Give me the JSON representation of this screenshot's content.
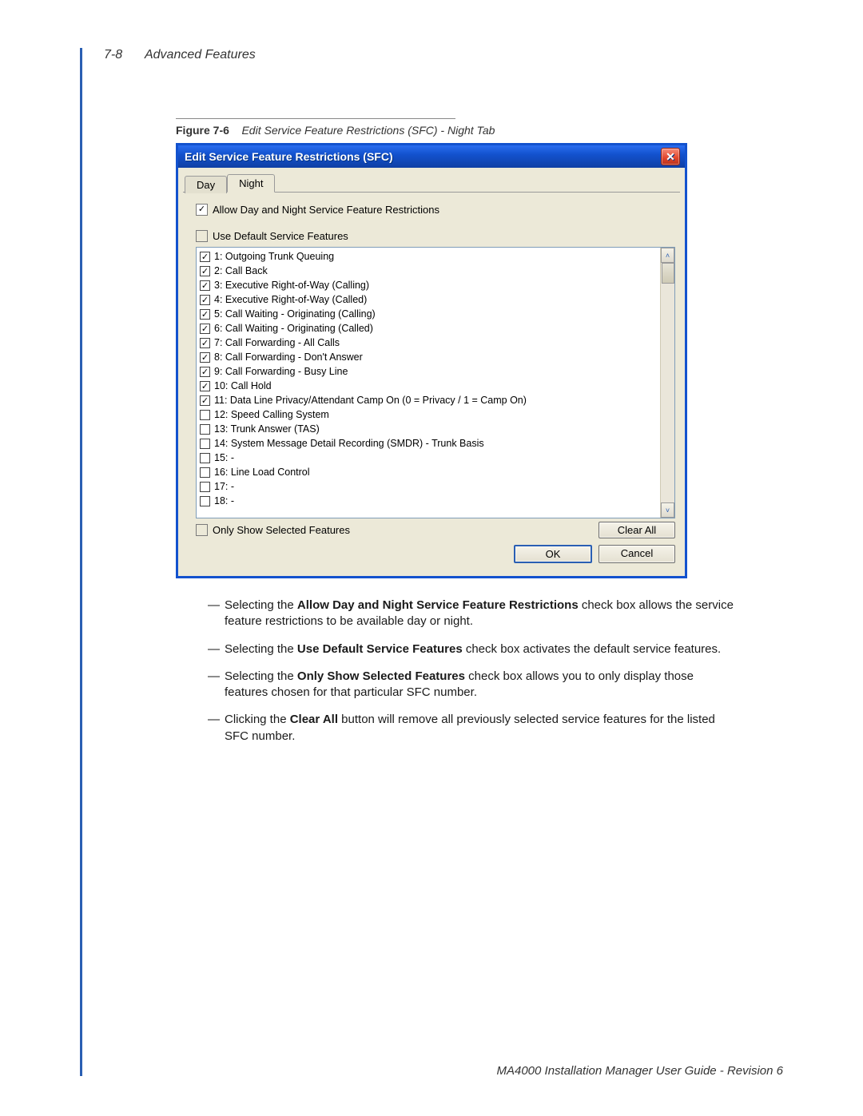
{
  "page": {
    "page_num": "7-8",
    "section": "Advanced Features"
  },
  "figure": {
    "label": "Figure 7-6",
    "title": "Edit Service Feature Restrictions (SFC) - Night Tab"
  },
  "dialog": {
    "title": "Edit Service Feature Restrictions (SFC)",
    "close_glyph": "✕",
    "tabs": {
      "day": "Day",
      "night": "Night",
      "active": "night"
    },
    "allow_label": "Allow Day and Night Service Feature Restrictions",
    "allow_checked": true,
    "use_default_label": "Use Default Service Features",
    "use_default_checked": false,
    "features": [
      {
        "checked": true,
        "label": "1: Outgoing Trunk Queuing"
      },
      {
        "checked": true,
        "label": "2: Call Back"
      },
      {
        "checked": true,
        "label": "3: Executive Right-of-Way (Calling)"
      },
      {
        "checked": true,
        "label": "4: Executive Right-of-Way (Called)"
      },
      {
        "checked": true,
        "label": "5: Call Waiting - Originating (Calling)"
      },
      {
        "checked": true,
        "label": "6: Call Waiting - Originating (Called)"
      },
      {
        "checked": true,
        "label": "7: Call Forwarding - All Calls"
      },
      {
        "checked": true,
        "label": "8: Call Forwarding - Don't Answer"
      },
      {
        "checked": true,
        "label": "9: Call Forwarding - Busy Line"
      },
      {
        "checked": true,
        "label": "10: Call Hold"
      },
      {
        "checked": true,
        "label": "11: Data Line Privacy/Attendant Camp On (0 = Privacy / 1 = Camp On)"
      },
      {
        "checked": false,
        "label": "12: Speed Calling System"
      },
      {
        "checked": false,
        "label": "13: Trunk Answer (TAS)"
      },
      {
        "checked": false,
        "label": "14: System Message Detail Recording (SMDR) - Trunk Basis"
      },
      {
        "checked": false,
        "label": "15: -"
      },
      {
        "checked": false,
        "label": "16: Line Load Control"
      },
      {
        "checked": false,
        "label": "17: -"
      },
      {
        "checked": false,
        "label": "18: -"
      }
    ],
    "only_selected_label": "Only Show Selected Features",
    "only_selected_checked": false,
    "clear_all": "Clear All",
    "ok": "OK",
    "cancel": "Cancel"
  },
  "bullets": {
    "b1_pre": "Selecting the ",
    "b1_bold": "Allow Day and Night Service Feature Restrictions",
    "b1_post": " check box allows the service feature restrictions to be available day or night.",
    "b2_pre": "Selecting the ",
    "b2_bold": "Use Default Service Features",
    "b2_post": " check box activates the default service features.",
    "b3_pre": "Selecting the ",
    "b3_bold": "Only Show Selected Features",
    "b3_post": " check box allows you to only display those features chosen for that particular SFC number.",
    "b4_pre": "Clicking the ",
    "b4_bold": "Clear All",
    "b4_post": " button will remove all previously selected service features for the listed SFC number."
  },
  "footer": "MA4000 Installation Manager User Guide - Revision 6",
  "glyphs": {
    "dash": "— ",
    "check": "✓",
    "up": "˄",
    "down": "˅"
  }
}
